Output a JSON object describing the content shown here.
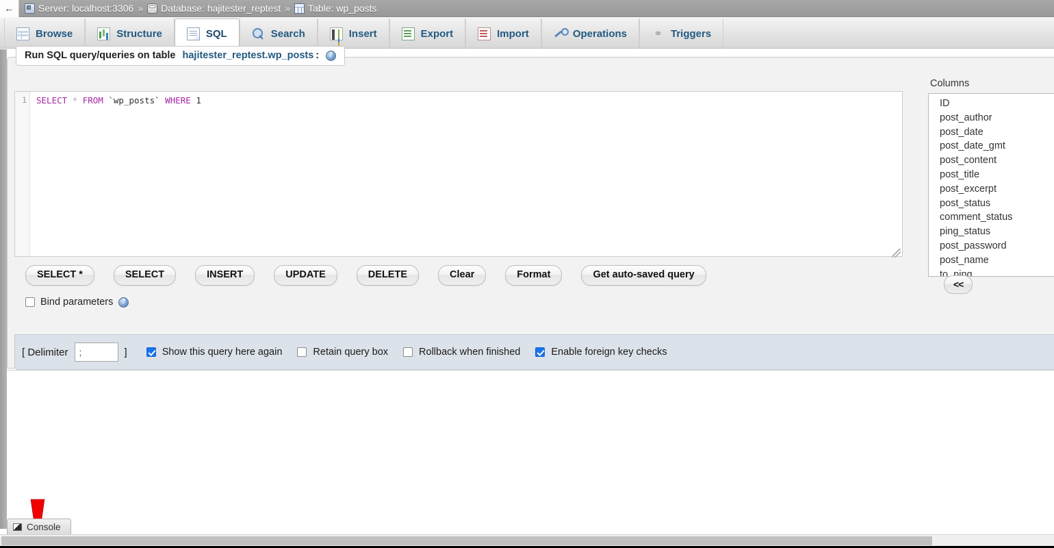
{
  "breadcrumb": {
    "back_label": "←",
    "items": [
      {
        "icon": "server-icon",
        "label": "Server: localhost:3306"
      },
      {
        "icon": "database-icon",
        "label": "Database: hajitester_reptest"
      },
      {
        "icon": "table-icon",
        "label": "Table: wp_posts"
      }
    ],
    "separator": "»"
  },
  "tabs": [
    {
      "label": "Browse",
      "icon": "browse-icon",
      "active": false
    },
    {
      "label": "Structure",
      "icon": "structure-icon",
      "active": false
    },
    {
      "label": "SQL",
      "icon": "sql-icon",
      "active": true
    },
    {
      "label": "Search",
      "icon": "search-icon",
      "active": false
    },
    {
      "label": "Insert",
      "icon": "insert-icon",
      "active": false
    },
    {
      "label": "Export",
      "icon": "export-icon",
      "active": false
    },
    {
      "label": "Import",
      "icon": "import-icon",
      "active": false
    },
    {
      "label": "Operations",
      "icon": "operations-icon",
      "active": false
    },
    {
      "label": "Triggers",
      "icon": "triggers-icon",
      "active": false
    }
  ],
  "query_panel": {
    "legend_prefix": "Run SQL query/queries on table",
    "legend_table": "hajitester_reptest.wp_posts",
    "legend_suffix": ":",
    "help_glyph": "?",
    "editor": {
      "line_number": "1",
      "tokens": [
        {
          "text": "SELECT",
          "type": "keyword"
        },
        {
          "text": " ",
          "type": "plain"
        },
        {
          "text": "*",
          "type": "star"
        },
        {
          "text": " ",
          "type": "plain"
        },
        {
          "text": "FROM",
          "type": "keyword"
        },
        {
          "text": " `wp_posts` ",
          "type": "plain"
        },
        {
          "text": "WHERE",
          "type": "keyword"
        },
        {
          "text": " 1",
          "type": "plain"
        }
      ],
      "plain_text": "SELECT * FROM `wp_posts` WHERE 1"
    },
    "buttons": [
      "SELECT *",
      "SELECT",
      "INSERT",
      "UPDATE",
      "DELETE",
      "Clear",
      "Format",
      "Get auto-saved query"
    ],
    "bind_parameters": {
      "label": "Bind parameters",
      "checked": false,
      "help_glyph": "?"
    }
  },
  "columns_panel": {
    "title": "Columns",
    "items": [
      "ID",
      "post_author",
      "post_date",
      "post_date_gmt",
      "post_content",
      "post_title",
      "post_excerpt",
      "post_status",
      "comment_status",
      "ping_status",
      "post_password",
      "post_name",
      "to_ping"
    ],
    "collapse_label": "<<"
  },
  "options_bar": {
    "delimiter_open": "[ Delimiter",
    "delimiter_value": ";",
    "delimiter_close": "]",
    "checkboxes": [
      {
        "label": "Show this query here again",
        "checked": true
      },
      {
        "label": "Retain query box",
        "checked": false
      },
      {
        "label": "Rollback when finished",
        "checked": false
      },
      {
        "label": "Enable foreign key checks",
        "checked": true
      }
    ]
  },
  "console": {
    "label": "Console",
    "icon": "console-icon"
  },
  "annotation": {
    "type": "red-arrow-pointer",
    "color": "#f20000"
  },
  "colors": {
    "accent_link": "#235a81",
    "checkbox_checked": "#1a73e8",
    "panel_bg": "#f2f2f2",
    "options_bar_bg": "#dce2e9",
    "breadcrumb_bg": "#9e9e9e",
    "annotation_red": "#f20000"
  }
}
